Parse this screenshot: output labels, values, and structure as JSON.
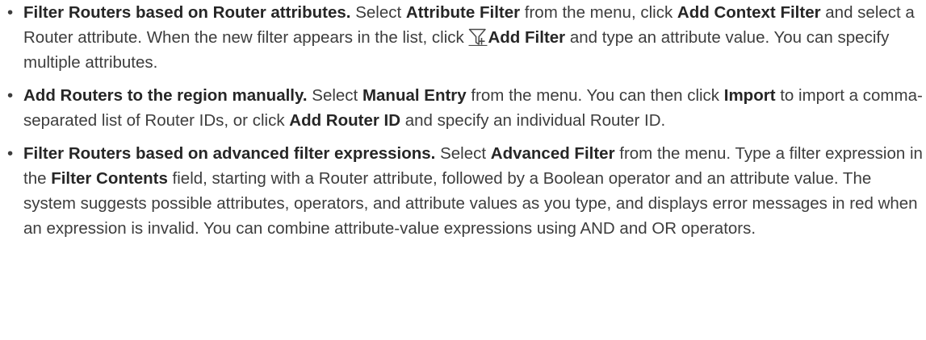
{
  "items": [
    {
      "bullet": "•",
      "lead": "Filter Routers based on Router attributes.",
      "t1": " Select ",
      "b1": "Attribute Filter",
      "t2": " from the menu, click ",
      "b2": "Add Context Filter",
      "t3": " and select a Router attribute. When the new filter appears in the list, click ",
      "icon": "add-filter-icon",
      "b3": "Add Filter",
      "t4": " and type an attribute value. You can specify multiple attributes."
    },
    {
      "bullet": "•",
      "lead": "Add Routers to the region manually.",
      "t1": " Select ",
      "b1": "Manual Entry",
      "t2": " from the menu. You can then click ",
      "b2": "Import",
      "t3": " to import a comma-separated list of Router IDs, or click ",
      "b3": "Add Router ID",
      "t4": " and specify an individual Router ID."
    },
    {
      "bullet": "•",
      "lead": "Filter Routers based on advanced filter expressions.",
      "t1": " Select ",
      "b1": "Advanced Filter",
      "t2": " from the menu. Type a filter expression in the ",
      "b2": "Filter Contents",
      "t3": " field, starting with a Router attribute, followed by a Boolean operator and an attribute value. The system suggests possible attributes, operators, and attribute values as you type, and displays error messages in red when an expression is invalid. You can combine attribute-value expressions using AND and OR operators."
    }
  ]
}
